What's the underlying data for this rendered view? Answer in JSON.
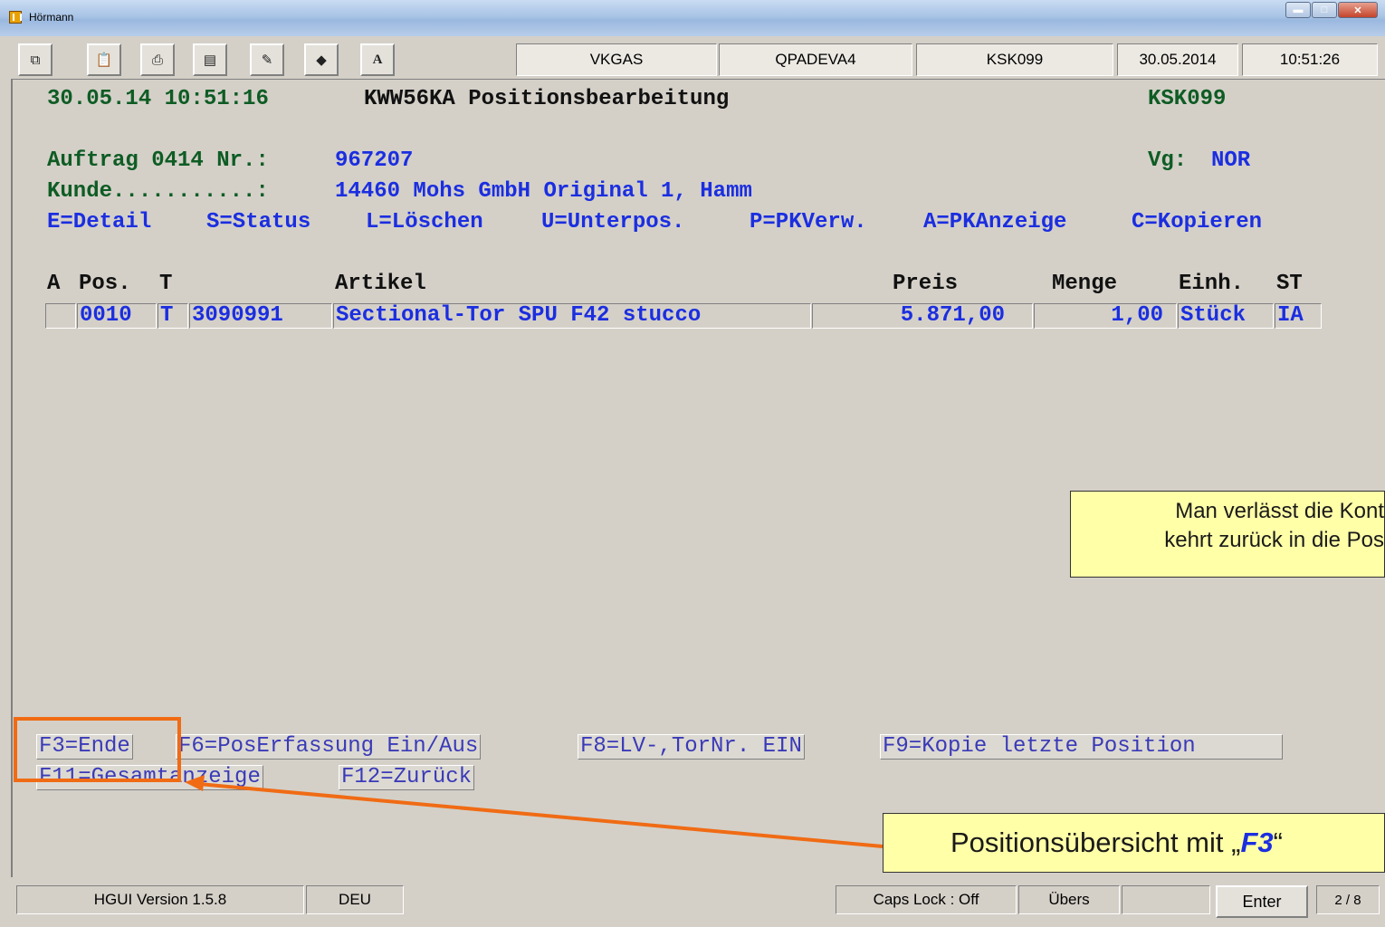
{
  "window": {
    "title": "Hörmann"
  },
  "toolbar": {
    "buttons": [
      "copy-icon",
      "paste-icon",
      "print-icon",
      "print-screen-icon",
      "print-setup-icon",
      "diamond-icon",
      "font-icon"
    ],
    "font_button_label": "A",
    "fields": [
      "VKGAS",
      "QPADEVA4",
      "KSK099",
      "30.05.2014",
      "10:51:26"
    ]
  },
  "screen": {
    "header_datetime": "30.05.14 10:51:16",
    "header_program": "KWW56KA Positionsbearbeitung",
    "header_station": "KSK099",
    "order_label": "Auftrag 0414 Nr.:",
    "order_number": "967207",
    "vg_label": "Vg:",
    "vg_value": "NOR",
    "customer_label": "Kunde...........:",
    "customer_value": "14460 Mohs GmbH Original 1, Hamm",
    "options": [
      "E=Detail",
      "S=Status",
      "L=Löschen",
      "U=Unterpos.",
      "P=PKVerw.",
      "A=PKAnzeige",
      "C=Kopieren"
    ],
    "columns": [
      "A",
      "Pos.",
      "T",
      "Artikel",
      "Preis",
      "Menge",
      "Einh.",
      "ST"
    ],
    "rows": [
      {
        "a": "",
        "pos": "0010",
        "t": "T",
        "article_no": "3090991",
        "article": "Sectional-Tor SPU F42 stucco",
        "price": "5.871,00",
        "qty": "1,00",
        "unit": "Stück",
        "st": "IA"
      }
    ],
    "function_keys_row1": [
      "F3=Ende",
      "F6=PosErfassung Ein/Aus",
      "F8=LV-,TorNr. EIN",
      "F9=Kopie letzte Position"
    ],
    "function_keys_row2": [
      "F11=Gesamtanzeige",
      "F12=Zurück"
    ]
  },
  "statusbar": {
    "version": "HGUI Version 1.5.8",
    "language": "DEU",
    "caps_lock": "Caps Lock : Off",
    "mode": "Übers",
    "blank": "",
    "enter_label": "Enter",
    "page": "2 / 8"
  },
  "annotations": {
    "callout1_line1": "Man verlässt die Kont",
    "callout1_line2": "kehrt zurück in die Pos",
    "callout2_prefix": "Positionsübersicht mit „",
    "callout2_key": "F3",
    "callout2_suffix": "“",
    "highlight_color": "#f06b14",
    "callout_bg": "#ffffa8"
  },
  "colors": {
    "terminal_green": "#0e5c24",
    "terminal_blue": "#1b2ee0",
    "terminal_bg": "#d4d0c8"
  }
}
